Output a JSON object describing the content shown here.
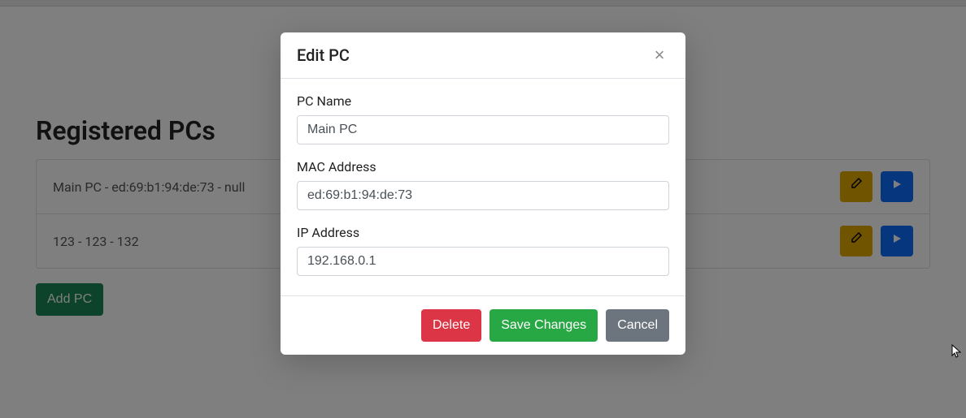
{
  "page_title": "Registered PCs",
  "list": {
    "items": [
      {
        "text": "Main PC - ed:69:b1:94:de:73 - null"
      },
      {
        "text": "123 - 123 - 132"
      }
    ]
  },
  "buttons": {
    "add_pc": "Add PC"
  },
  "modal": {
    "title": "Edit PC",
    "fields": {
      "pc_name": {
        "label": "PC Name",
        "value": "Main PC"
      },
      "mac": {
        "label": "MAC Address",
        "value": "ed:69:b1:94:de:73"
      },
      "ip": {
        "label": "IP Address",
        "value": "192.168.0.1"
      }
    },
    "footer": {
      "delete": "Delete",
      "save": "Save Changes",
      "cancel": "Cancel"
    }
  },
  "icons": {
    "edit": "edit-icon",
    "play": "play-icon",
    "close": "close-icon"
  }
}
